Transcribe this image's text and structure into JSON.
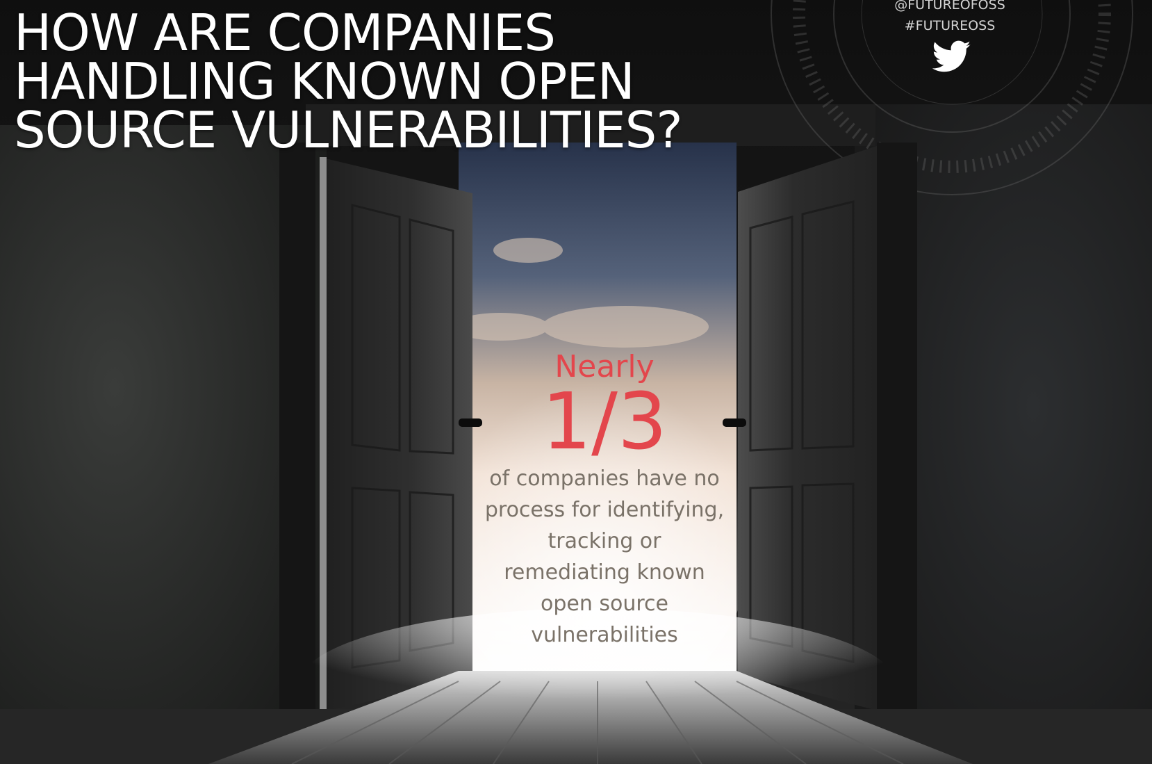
{
  "slide": {
    "title_lines": [
      "HOW ARE COMPANIES",
      "HANDLING KNOWN OPEN",
      "SOURCE VULNERABILITIES?"
    ],
    "social": {
      "handle": "@FUTUREOFOSS",
      "hashtag": "#FUTUREOSS",
      "icon": "twitter-bird-icon"
    },
    "stat": {
      "prefix": "Nearly",
      "value": "1/3",
      "description": "of companies have no process for identifying, tracking or remediating known open source vulnerabilities"
    },
    "colors": {
      "accent": "#e3464c",
      "title": "#ffffff",
      "description": "#7a7268",
      "social": "#d4d4d4"
    }
  }
}
